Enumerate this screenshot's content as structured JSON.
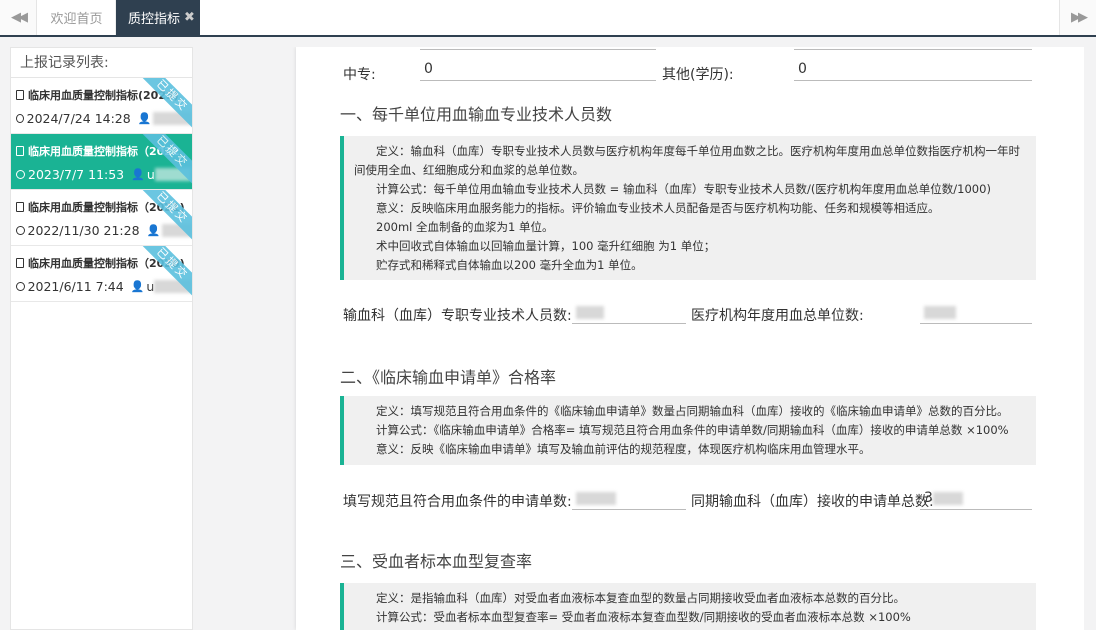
{
  "tabbar": {
    "home_tab": "欢迎首页",
    "active_tab": "质控指标",
    "close_glyph": "✖",
    "left_arrow": "◀◀",
    "right_arrow": "▶▶"
  },
  "sidebar": {
    "title": "上报记录列表:",
    "records": [
      {
        "title": "临床用血质量控制指标(2023)",
        "time": "2024/7/24 14:28",
        "ribbon": "已提交"
      },
      {
        "title": "临床用血质量控制指标（2022",
        "time": "2023/7/7 11:53",
        "user_prefix": "u",
        "ribbon": "已提交"
      },
      {
        "title": "临床用血质量控制指标（2021)",
        "time": "2022/11/30 21:28",
        "ribbon": "已提交"
      },
      {
        "title": "临床用血质量控制指标（2020)",
        "time": "2021/6/11 7:44",
        "user_prefix": "u",
        "ribbon": "已提交"
      }
    ]
  },
  "form": {
    "zhongzhuan_label": "中专:",
    "zhongzhuan_value": "0",
    "other_label": "其他(学历):",
    "other_value": "0",
    "s1": {
      "heading": "一、每千单位用血输血专业技术人员数",
      "lines": [
        "定义：输血科（血库）专职专业技术人员数与医疗机构年度每千单位用血数之比。医疗机构年度用血总单位数指医疗机构一年时间使用全血、红细胞成分和血浆的总单位数。",
        "计算公式：每千单位用血输血专业技术人员数 = 输血科（血库）专职专业技术人员数/(医疗机构年度用血总单位数/1000)",
        "意义：反映临床用血服务能力的指标。评价输血专业技术人员配备是否与医疗机构功能、任务和规模等相适应。",
        "200ml 全血制备的血浆为1 单位。",
        "术中回收式自体输血以回输血量计算，100 毫升红细胞 为1 单位；",
        "贮存式和稀释式自体输血以200 毫升全血为1 单位。"
      ],
      "field1_label": "输血科（血库）专职专业技术人员数:",
      "field2_label": "医疗机构年度用血总单位数:"
    },
    "s2": {
      "heading": "二、《临床输血申请单》合格率",
      "lines": [
        "定义：填写规范且符合用血条件的《临床输血申请单》数量占同期输血科（血库）接收的《临床输血申请单》总数的百分比。",
        "计算公式：《临床输血申请单》合格率= 填写规范且符合用血条件的申请单数/同期输血科（血库）接收的申请单总数 ×100%",
        "意义：反映《临床输血申请单》填写及输血前评估的规范程度，体现医疗机构临床用血管理水平。"
      ],
      "field1_label": "填写规范且符合用血条件的申请单数:",
      "field2_label": "同期输血科（血库）接收的申请单总数:",
      "field2_value_prefix": "3"
    },
    "s3": {
      "heading": "三、受血者标本血型复查率",
      "lines": [
        "定义：是指输血科（血库）对受血者血液标本复查血型的数量占同期接收受血者血液标本总数的百分比。",
        "计算公式：受血者标本血型复查率= 受血者血液标本复查血型数/同期接收的受血者血液标本总数 ×100%"
      ]
    }
  },
  "colors": {
    "accent": "#1ab394",
    "dark": "#2f4050",
    "ribbon": "#5bc0de"
  }
}
